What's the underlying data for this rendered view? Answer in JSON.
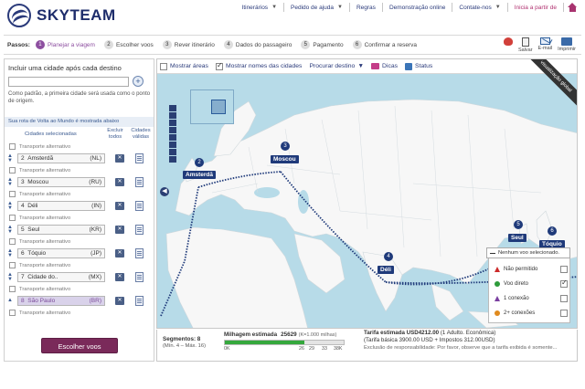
{
  "header": {
    "logo_text": "SKYTEAM",
    "nav": [
      {
        "label": "Itinerários",
        "arrow": "▼"
      },
      {
        "label": "Pedido de ajuda",
        "arrow": "▼"
      },
      {
        "label": "Regras",
        "arrow": ""
      },
      {
        "label": "Demonstração online",
        "arrow": ""
      },
      {
        "label": "Contate-nos",
        "arrow": "▼"
      },
      {
        "label": "Inicia a partir de",
        "arrow": ""
      }
    ]
  },
  "steps": {
    "label": "Passos:",
    "items": [
      {
        "num": "1",
        "label": "Planejar a viagem"
      },
      {
        "num": "2",
        "label": "Escolher voos"
      },
      {
        "num": "3",
        "label": "Rever itinerário"
      },
      {
        "num": "4",
        "label": "Dados do passageiro"
      },
      {
        "num": "5",
        "label": "Pagamento"
      },
      {
        "num": "6",
        "label": "Confirmar a reserva"
      }
    ],
    "tools": {
      "save": "Salvar",
      "email": "E-mail",
      "print": "Imprimir"
    }
  },
  "left": {
    "include_title": "Incluir uma cidade após cada destino",
    "input_value": "",
    "add_symbol": "+",
    "origin_hint": "Como padrão, a primeira cidade será usada como o ponto de origem.",
    "route_bar": "Sua rota de Volta ao Mundo é mostrada abaixo",
    "col_city": "Cidades selecionadas",
    "col_exclude": "Excluir todos",
    "col_valid": "Cidades válidas",
    "alt_label": "Transporte alternativo",
    "exclude_symbol": "✕",
    "cities": [
      {
        "num": "2",
        "name": "Amsterdã",
        "code": "(NL)"
      },
      {
        "num": "3",
        "name": "Moscou",
        "code": "(RU)"
      },
      {
        "num": "4",
        "name": "Déli",
        "code": "(IN)"
      },
      {
        "num": "5",
        "name": "Seul",
        "code": "(KR)"
      },
      {
        "num": "6",
        "name": "Tóquio",
        "code": "(JP)"
      },
      {
        "num": "7",
        "name": "Cidade do..",
        "code": "(MX)"
      },
      {
        "num": "8",
        "name": "São Paulo",
        "code": "(BR)"
      }
    ],
    "choose_button": "Escolher voos"
  },
  "map": {
    "toolbar": {
      "show_areas": "Mostrar áreas",
      "show_city_names": "Mostrar nomes das cidades",
      "find_flight": "Procurar destino",
      "find_arrow": "▼",
      "tips": "Dicas",
      "status": "Status"
    },
    "ribbon": "visualização global",
    "left_arrow": "◀",
    "cities": [
      {
        "pin": "2",
        "label": "Amsterdã"
      },
      {
        "pin": "3",
        "label": "Moscou"
      },
      {
        "pin": "4",
        "label": "Déli"
      },
      {
        "pin": "5",
        "label": "Seul"
      },
      {
        "pin": "6",
        "label": "Tóquio"
      }
    ],
    "legend": {
      "header": "Nenhum voo selecionado.",
      "items": [
        {
          "label": "Não permitido",
          "color": "#cc2a2a",
          "checked": false
        },
        {
          "label": "Voo direto",
          "color": "#2e9b3a",
          "checked": true
        },
        {
          "label": "1 conexão",
          "color": "#7a3fa0",
          "checked": false
        },
        {
          "label": "2+ conexões",
          "color": "#e08a1e",
          "checked": false
        }
      ]
    }
  },
  "summary": {
    "segments_title": "Segmentos: 8",
    "segments_sub": "(Mín. 4 – Máx. 16)",
    "miles_title": "Milhagem estimada",
    "miles_value": "25629",
    "miles_unit": "(K=1.000 milhas)",
    "miles_ticks": [
      "0K",
      "26",
      "29",
      "33",
      "38K"
    ],
    "miles_fraction": 0.67,
    "fare_title": "Tarifa estimada USD4212.00",
    "fare_note": "(1 Adulto. Econômica)",
    "fare_detail": "(Tarifa básica 3900.00 USD + Impostos 312.00USD)",
    "fare_disclaimer": "Exclusão de responsabilidade: Por favor, observe que a tarifa exibida é somente..."
  },
  "colors": {
    "brand": "#1e2d6b",
    "accent_purple": "#8d4fa0",
    "button": "#7a2a5a",
    "sea": "#b7dbe8",
    "land": "#f7f7f7",
    "route": "#1f3a7a"
  }
}
